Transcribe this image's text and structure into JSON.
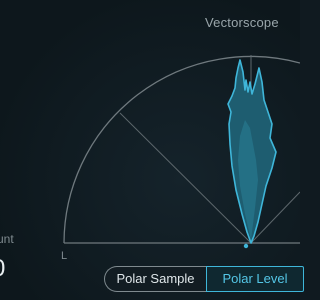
{
  "window": {
    "title": "Vectorscope"
  },
  "side_panel": {
    "label": "unt",
    "value": "0"
  },
  "scope": {
    "axis_left_label": "L"
  },
  "tabs": [
    {
      "label": "Polar Sample",
      "selected": false
    },
    {
      "label": "Polar Level",
      "selected": true
    }
  ],
  "colors": {
    "accent": "#3fb6d9",
    "grid": "#7b858a",
    "background": "#101a20"
  }
}
